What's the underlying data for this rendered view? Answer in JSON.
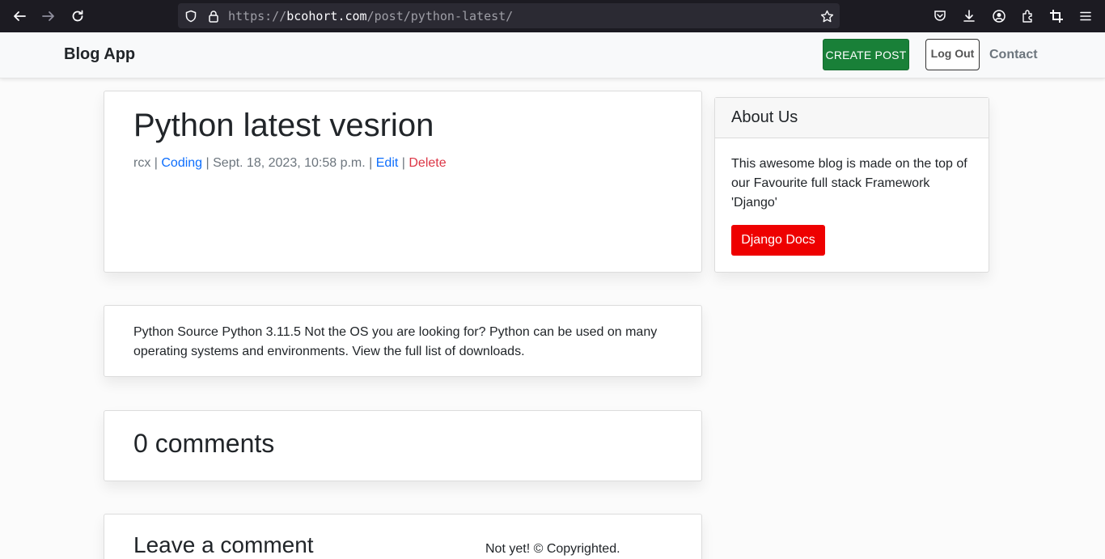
{
  "browser": {
    "url_scheme": "https://",
    "url_host": "bcohort.com",
    "url_path": "/post/python-latest/"
  },
  "navbar": {
    "brand": "Blog App",
    "create_post": "CREATE POST",
    "logout": "Log Out",
    "contact": "Contact"
  },
  "post": {
    "title": "Python latest vesrion",
    "author": "rcx",
    "category": "Coding",
    "date": "Sept. 18, 2023, 10:58 p.m.",
    "edit": "Edit",
    "delete": "Delete",
    "separator": " | ",
    "body": "Python Source Python 3.11.5 Not the OS you are looking for? Python can be used on many operating systems and environments. View the full list of downloads."
  },
  "sidebar": {
    "title": "About Us",
    "text": "This awesome blog is made on the top of our Favourite full stack Framework 'Django'",
    "docs_button": "Django Docs"
  },
  "comments": {
    "count_label": "0 comments",
    "leave_title": "Leave a comment"
  },
  "footer": {
    "text": "Not yet! © Copyrighted."
  },
  "colors": {
    "create_post_bg": "#198038",
    "docs_button_bg": "#ee0000",
    "link": "#0d6efd",
    "danger": "#dc3545"
  }
}
